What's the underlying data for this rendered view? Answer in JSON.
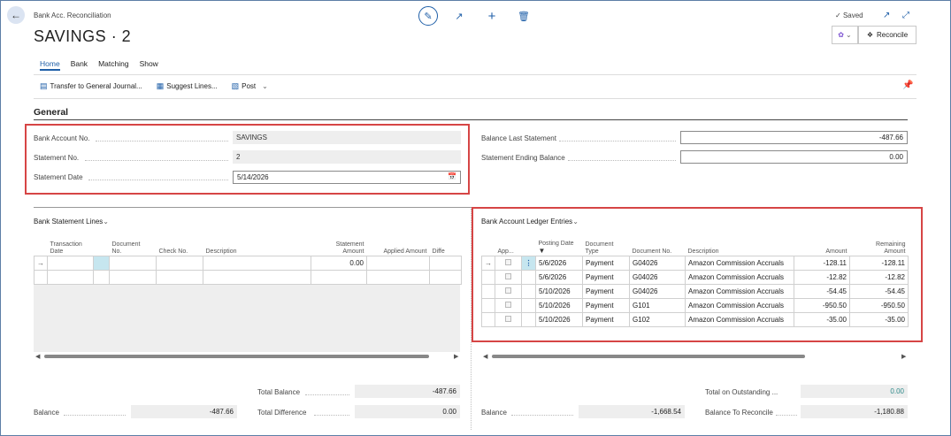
{
  "header": {
    "breadcrumb": "Bank Acc. Reconciliation",
    "title": "SAVINGS · 2",
    "saved": "Saved",
    "reconcile": "Reconcile"
  },
  "tabs": [
    "Home",
    "Bank",
    "Matching",
    "Show"
  ],
  "actions": {
    "transfer": "Transfer to General Journal...",
    "suggest": "Suggest Lines...",
    "post": "Post"
  },
  "general": {
    "heading": "General",
    "bank_account_label": "Bank Account No.",
    "bank_account": "SAVINGS",
    "statement_no_label": "Statement No.",
    "statement_no": "2",
    "statement_date_label": "Statement Date",
    "statement_date": "5/14/2026",
    "balance_last_label": "Balance Last Statement",
    "balance_last": "-487.66",
    "ending_balance_label": "Statement Ending Balance",
    "ending_balance": "0.00"
  },
  "statement_lines": {
    "title": "Bank Statement Lines",
    "columns": [
      "Transaction\nDate",
      "Document\nNo.",
      "Check No.",
      "Description",
      "Statement\nAmount",
      "Applied Amount",
      "Diffe"
    ],
    "row_amount": "0.00"
  },
  "ledger": {
    "title": "Bank Account Ledger Entries",
    "columns": [
      "App...",
      "Posting Date",
      "Document\nType",
      "Document No.",
      "Description",
      "Amount",
      "Remaining\nAmount"
    ],
    "rows": [
      {
        "date": "5/6/2026",
        "type": "Payment",
        "doc": "G04026",
        "desc": "Amazon Commission Accruals",
        "amount": "-128.11",
        "remaining": "-128.11"
      },
      {
        "date": "5/6/2026",
        "type": "Payment",
        "doc": "G04026",
        "desc": "Amazon Commission Accruals",
        "amount": "-12.82",
        "remaining": "-12.82"
      },
      {
        "date": "5/10/2026",
        "type": "Payment",
        "doc": "G04026",
        "desc": "Amazon Commission Accruals",
        "amount": "-54.45",
        "remaining": "-54.45"
      },
      {
        "date": "5/10/2026",
        "type": "Payment",
        "doc": "G101",
        "desc": "Amazon Commission Accruals",
        "amount": "-950.50",
        "remaining": "-950.50"
      },
      {
        "date": "5/10/2026",
        "type": "Payment",
        "doc": "G102",
        "desc": "Amazon Commission Accruals",
        "amount": "-35.00",
        "remaining": "-35.00"
      }
    ]
  },
  "footer": {
    "total_balance_label": "Total Balance",
    "total_balance": "-487.66",
    "balance_label": "Balance",
    "balance_left": "-487.66",
    "total_diff_label": "Total Difference",
    "total_diff": "0.00",
    "outstanding_label": "Total on Outstanding ...",
    "outstanding": "0.00",
    "balance_right": "-1,668.54",
    "to_reconcile_label": "Balance To Reconcile",
    "to_reconcile": "-1,180.88"
  },
  "colors": {
    "accent": "#1f5fa8",
    "highlight": "#d64545",
    "teal": "#2f8a8a"
  }
}
